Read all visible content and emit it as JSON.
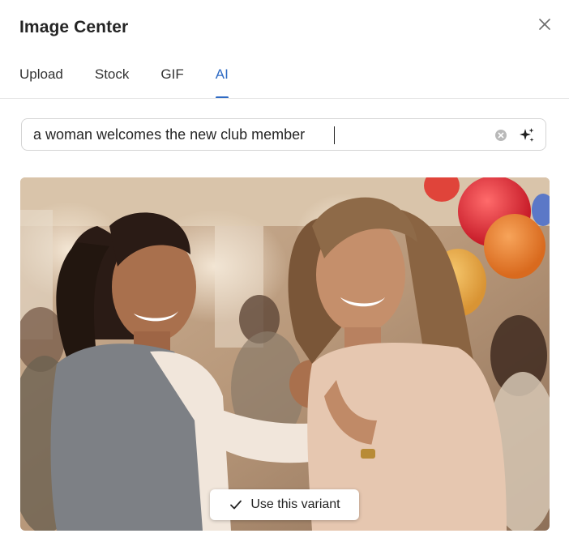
{
  "dialog": {
    "title": "Image Center",
    "close_icon": "close-icon"
  },
  "tabs": [
    {
      "label": "Upload",
      "active": false
    },
    {
      "label": "Stock",
      "active": false
    },
    {
      "label": "GIF",
      "active": false
    },
    {
      "label": "AI",
      "active": true
    }
  ],
  "search": {
    "value": "a woman welcomes the new club member",
    "clear_icon": "clear-circle-icon",
    "generate_icon": "sparkle-icon"
  },
  "result": {
    "image": "generated-ai-photo",
    "use_button_label": "Use this variant",
    "use_button_icon": "checkmark-icon"
  },
  "colors": {
    "accent": "#2f6bc4",
    "border": "#d4d4d4",
    "divider": "#e6e6e6"
  }
}
